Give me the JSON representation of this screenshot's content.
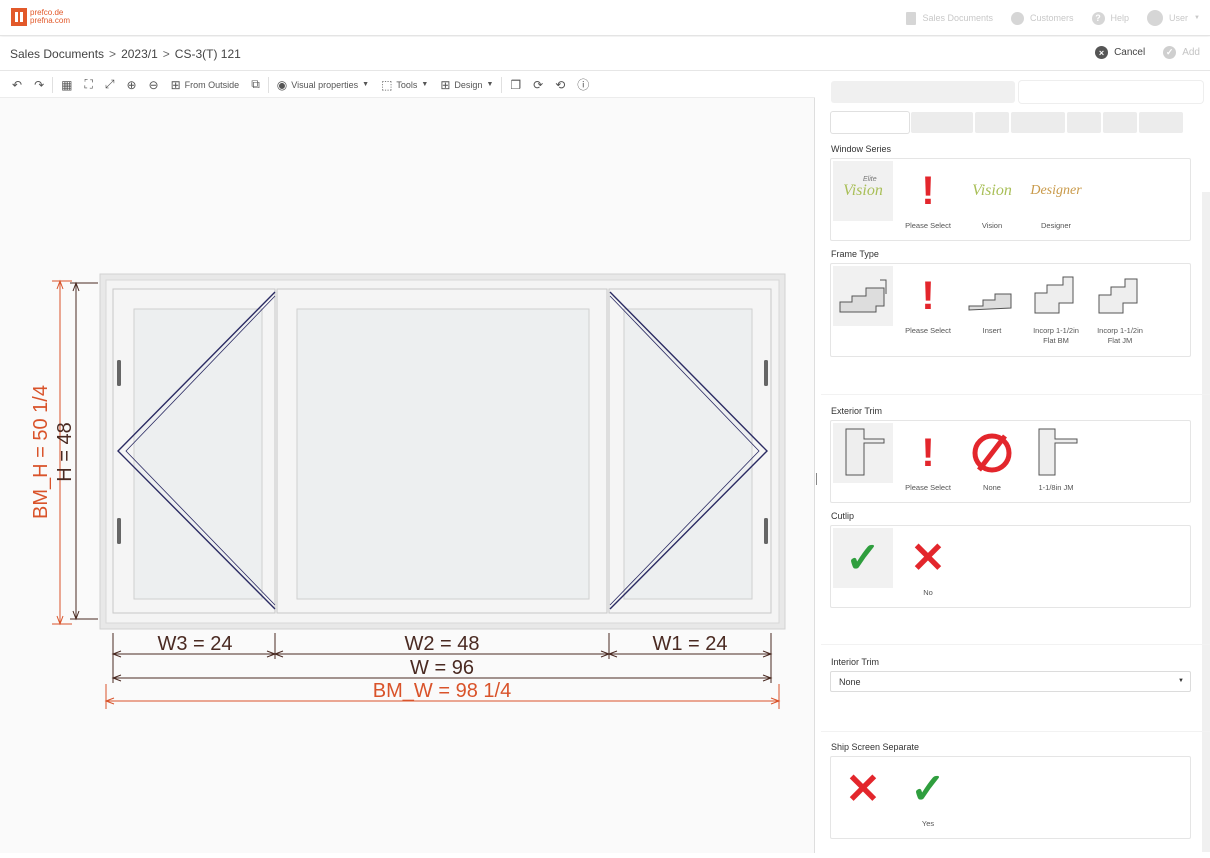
{
  "app": {
    "logo_line1": "prefco.de",
    "logo_line2": "prefna.com"
  },
  "topnav": [
    {
      "label": "Sales Documents",
      "icon": "document-icon"
    },
    {
      "label": "Customers",
      "icon": "users-icon"
    },
    {
      "label": "Help",
      "icon": "help-icon"
    },
    {
      "label": "User",
      "icon": "user-avatar-icon"
    }
  ],
  "breadcrumb": {
    "item1": "Sales Documents",
    "item2": "2023/1",
    "item3": "CS-3(T) 121",
    "separator": ">"
  },
  "actions": {
    "cancel": "Cancel",
    "add": "Add"
  },
  "toolbar": {
    "from_outside": "From Outside",
    "visual_properties": "Visual properties",
    "tools": "Tools",
    "design": "Design"
  },
  "drawing": {
    "bm_h": "BM_H = 50 1/4",
    "h": "H = 48",
    "w3": "W3 = 24",
    "w2": "W2 = 48",
    "w1": "W1 = 24",
    "w": "W = 96",
    "bm_w": "BM_W = 98 1/4",
    "colors": {
      "bm": "#d9532a",
      "dim": "#4a2a22",
      "sash": "#2b2b63"
    }
  },
  "panel": {
    "window_series": {
      "title": "Window Series",
      "options": [
        "",
        "Please Select",
        "Vision",
        "Designer"
      ],
      "logos": {
        "elite": "Elite",
        "vision": "Vision",
        "designer": "Designer"
      }
    },
    "frame_type": {
      "title": "Frame Type",
      "options": [
        "",
        "Please Select",
        "Insert",
        "Incorp 1-1/2in",
        "Incorp 1-1/2in"
      ],
      "options_line2": [
        "",
        "",
        "",
        "Flat BM",
        "Flat JM"
      ]
    },
    "exterior_trim": {
      "title": "Exterior Trim",
      "options": [
        "",
        "Please Select",
        "None",
        "1-1/8in JM"
      ]
    },
    "cutlip": {
      "title": "Cutlip",
      "options": [
        "",
        "No"
      ]
    },
    "interior_trim": {
      "title": "Interior Trim",
      "value": "None"
    },
    "ship_screen": {
      "title": "Ship Screen Separate",
      "options": [
        "",
        "Yes"
      ]
    }
  }
}
